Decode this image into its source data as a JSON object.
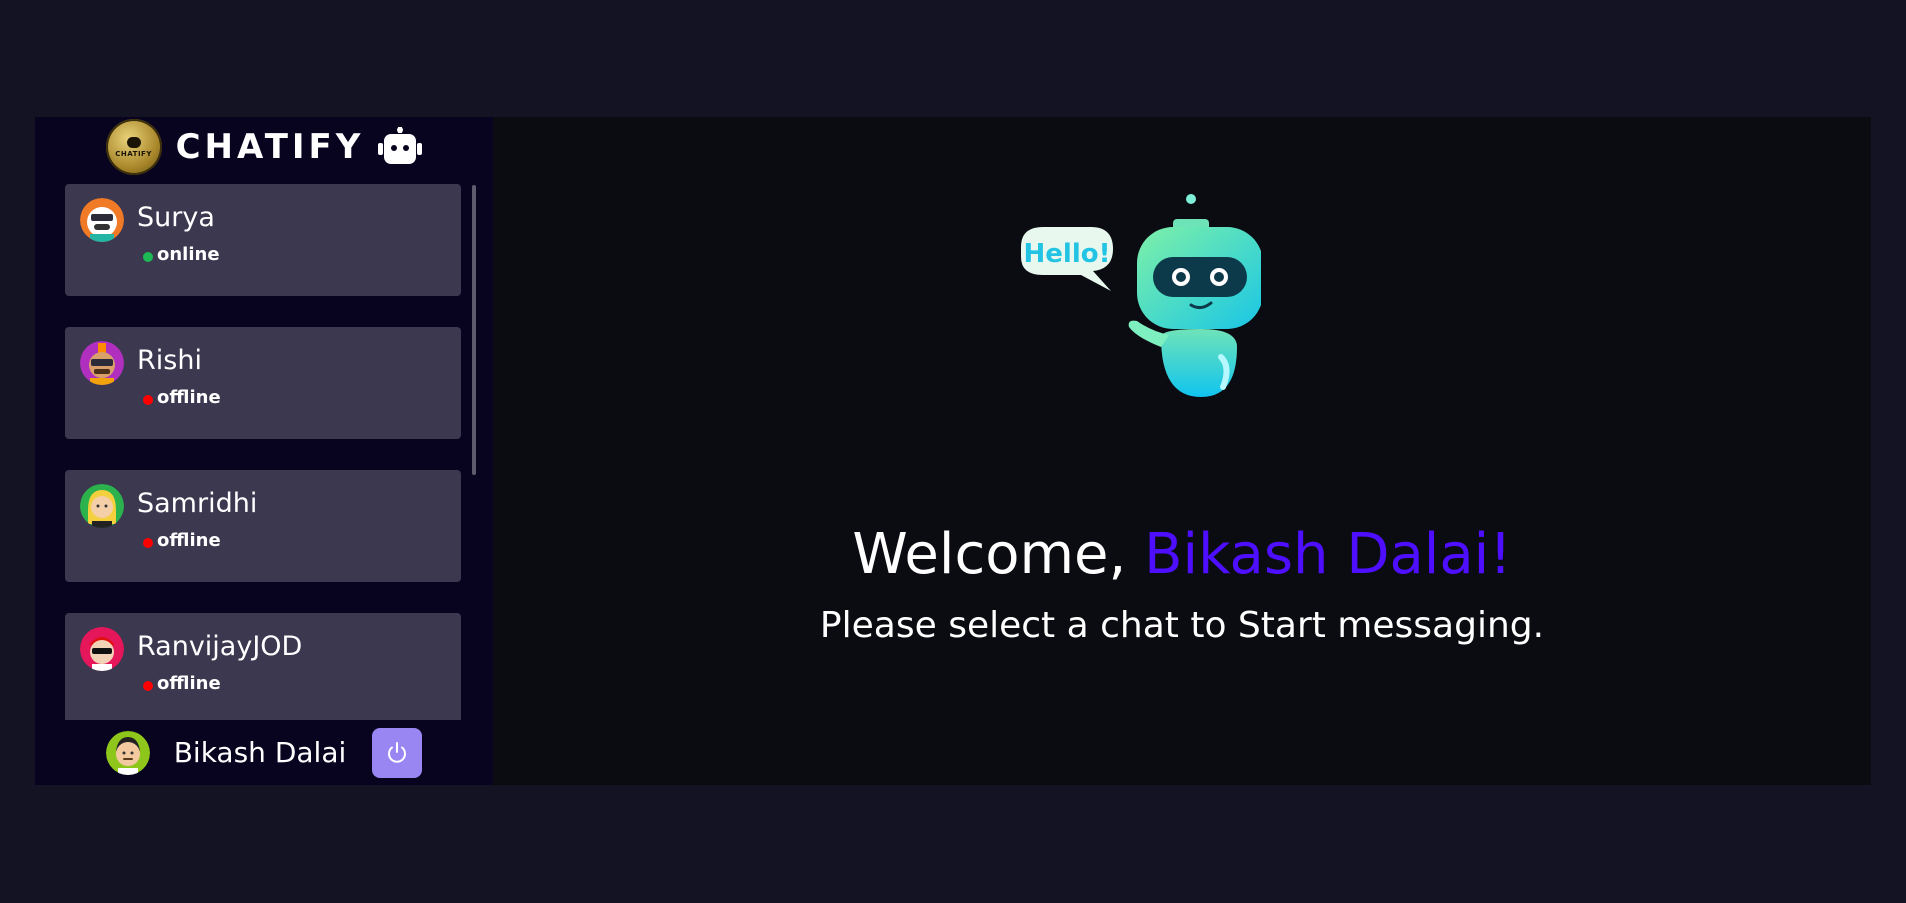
{
  "brand": {
    "name": "CHATIFY",
    "logo_text": "CHATIFY"
  },
  "contacts": [
    {
      "name": "Surya",
      "status": "online",
      "status_color": "#1db954",
      "avatar": "avatar-surya"
    },
    {
      "name": "Rishi",
      "status": "offline",
      "status_color": "#ff0000",
      "avatar": "avatar-rishi"
    },
    {
      "name": "Samridhi",
      "status": "offline",
      "status_color": "#ff0000",
      "avatar": "avatar-samridhi"
    },
    {
      "name": "RanvijayJOD",
      "status": "offline",
      "status_color": "#ff0000",
      "avatar": "avatar-ranvijay"
    }
  ],
  "current_user": {
    "name": "Bikash Dalai"
  },
  "welcome": {
    "greeting": "Welcome, ",
    "username": "Bikash Dalai!",
    "subtitle": "Please select a chat to Start messaging.",
    "bubble_text": "Hello!"
  },
  "colors": {
    "page_bg": "#131324",
    "sidebar_bg": "#080420",
    "card_bg": "#3b3850",
    "accent": "#4e0eff",
    "logout_bg": "#9a86f3"
  }
}
